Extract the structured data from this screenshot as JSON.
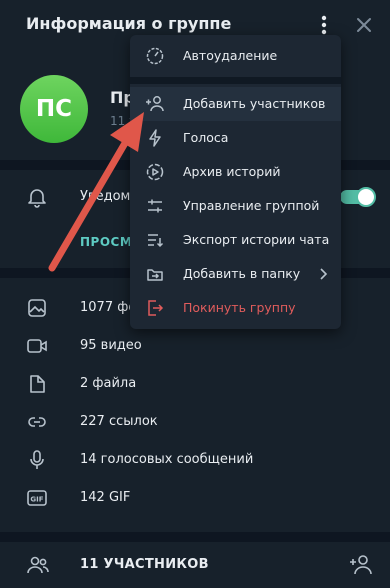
{
  "header": {
    "title": "Информация о группе",
    "more_icon": "more-vertical-icon",
    "close_icon": "close-icon"
  },
  "profile": {
    "avatar_initials": "ПС",
    "avatar_color": "#4fc447",
    "name_visible": "Пр",
    "subtitle_visible": "11 у"
  },
  "notifications": {
    "label_visible": "Уведомл",
    "toggle_on": true,
    "accent": "#53bda5"
  },
  "view_link": "ПРОСМО",
  "media": [
    {
      "icon": "photo-icon",
      "label": "1077 фот"
    },
    {
      "icon": "video-icon",
      "label": "95 видео"
    },
    {
      "icon": "file-icon",
      "label": "2 файла"
    },
    {
      "icon": "link-icon",
      "label": "227 ссылок"
    },
    {
      "icon": "microphone-icon",
      "label": "14 голосовых сообщений"
    },
    {
      "icon": "gif-icon",
      "label": "142 GIF"
    }
  ],
  "members": {
    "label": "11 УЧАСТНИКОВ",
    "add_icon": "add-user-icon"
  },
  "menu": {
    "items": [
      {
        "icon": "timer-icon",
        "label": "Автоудаление"
      },
      {
        "icon": "add-user-icon",
        "label": "Добавить участников"
      },
      {
        "icon": "lightning-icon",
        "label": "Голоса"
      },
      {
        "icon": "story-archive-icon",
        "label": "Архив историй"
      },
      {
        "icon": "sliders-icon",
        "label": "Управление группой"
      },
      {
        "icon": "export-icon",
        "label": "Экспорт истории чата"
      },
      {
        "icon": "folder-add-icon",
        "label": "Добавить в папку"
      },
      {
        "icon": "leave-icon",
        "label": "Покинуть группу"
      }
    ],
    "danger_color": "#e05c5c"
  },
  "annotation": {
    "arrow_color": "#e0574a"
  }
}
